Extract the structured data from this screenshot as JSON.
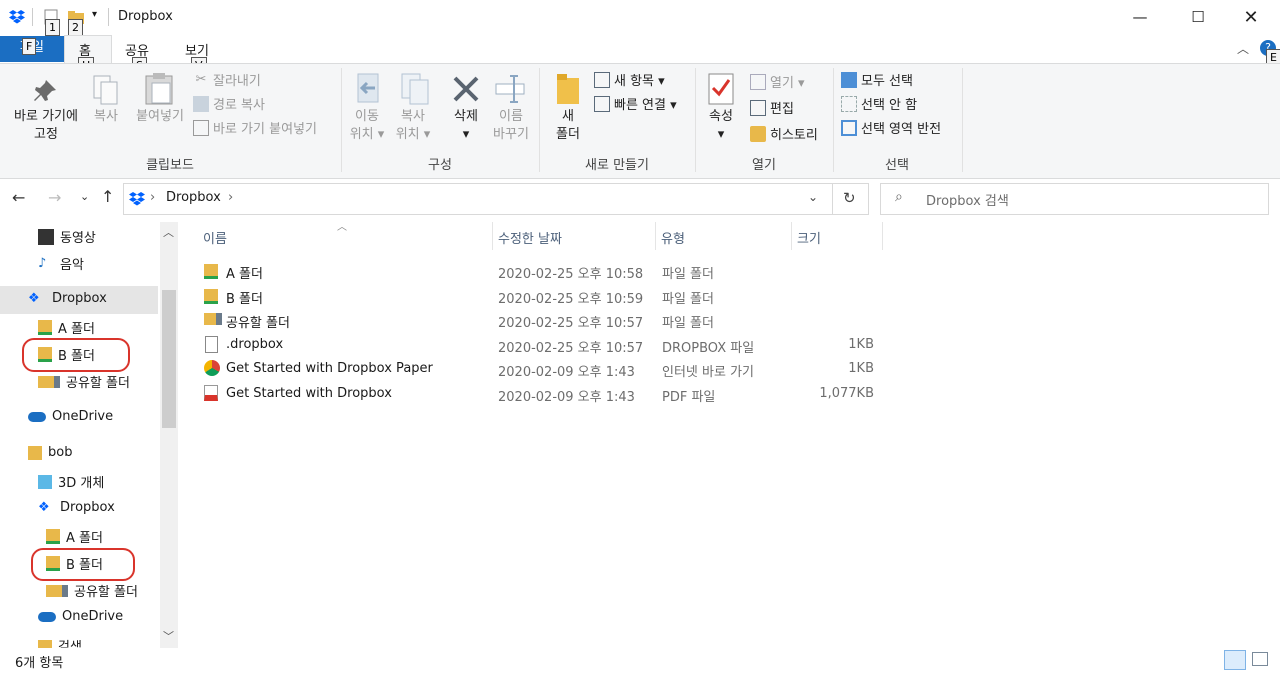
{
  "window": {
    "title": "Dropbox",
    "qat_keytips": [
      "1",
      "2"
    ]
  },
  "tabs": {
    "file": "파일",
    "file_keytip": "F",
    "home": "홈",
    "home_keytip": "H",
    "share": "공유",
    "share_keytip": "S",
    "view": "보기",
    "view_keytip": "V",
    "help_keytip": "E"
  },
  "ribbon": {
    "clipboard": {
      "pin": "바로 가기에\n고정",
      "copy": "복사",
      "paste": "붙여넣기",
      "cut": "잘라내기",
      "copy_path": "경로 복사",
      "paste_shortcut": "바로 가기 붙여넣기",
      "label": "클립보드"
    },
    "organize": {
      "move_to": "이동\n위치 ▾",
      "copy_to": "복사\n위치 ▾",
      "delete": "삭제\n▾",
      "rename": "이름\n바꾸기",
      "label": "구성"
    },
    "new": {
      "new_folder": "새\n폴더",
      "new_item": "새 항목 ▾",
      "easy_access": "빠른 연결 ▾",
      "label": "새로 만들기"
    },
    "open": {
      "properties": "속성\n▾",
      "open": "열기 ▾",
      "edit": "편집",
      "history": "히스토리",
      "label": "열기"
    },
    "select": {
      "select_all": "모두 선택",
      "select_none": "선택 안 함",
      "invert": "선택 영역 반전",
      "label": "선택"
    }
  },
  "address": {
    "crumb": "Dropbox",
    "search_placeholder": "Dropbox 검색"
  },
  "nav": {
    "items": [
      {
        "label": "동영상"
      },
      {
        "label": "음악"
      },
      {
        "label": "Dropbox"
      },
      {
        "label": "A 폴더"
      },
      {
        "label": "B 폴더"
      },
      {
        "label": "공유할 폴더"
      },
      {
        "label": "OneDrive"
      },
      {
        "label": "bob"
      },
      {
        "label": "3D 개체"
      },
      {
        "label": "Dropbox"
      },
      {
        "label": "A 폴더"
      },
      {
        "label": "B 폴더"
      },
      {
        "label": "공유할 폴더"
      },
      {
        "label": "OneDrive"
      },
      {
        "label": "검색"
      }
    ]
  },
  "columns": {
    "name": "이름",
    "modified": "수정한 날짜",
    "type": "유형",
    "size": "크기"
  },
  "files": [
    {
      "name": "A 폴더",
      "date": "2020-02-25 오후 10:58",
      "type": "파일 폴더",
      "size": "",
      "icon": "synced-folder-icon"
    },
    {
      "name": "B 폴더",
      "date": "2020-02-25 오후 10:59",
      "type": "파일 폴더",
      "size": "",
      "icon": "synced-folder-icon"
    },
    {
      "name": "공유할 폴더",
      "date": "2020-02-25 오후 10:57",
      "type": "파일 폴더",
      "size": "",
      "icon": "shared-folder-icon"
    },
    {
      "name": ".dropbox",
      "date": "2020-02-25 오후 10:57",
      "type": "DROPBOX 파일",
      "size": "1KB",
      "icon": "file-icon"
    },
    {
      "name": "Get Started with Dropbox Paper",
      "date": "2020-02-09 오후 1:43",
      "type": "인터넷 바로 가기",
      "size": "1KB",
      "icon": "chrome-icon"
    },
    {
      "name": "Get Started with Dropbox",
      "date": "2020-02-09 오후 1:43",
      "type": "PDF 파일",
      "size": "1,077KB",
      "icon": "pdf-icon"
    }
  ],
  "status": {
    "count": "6개 항목"
  },
  "colors": {
    "accent": "#1b6ec2",
    "highlight": "#d9342b",
    "dropbox": "#0061fe",
    "folder": "#e8b84a"
  }
}
